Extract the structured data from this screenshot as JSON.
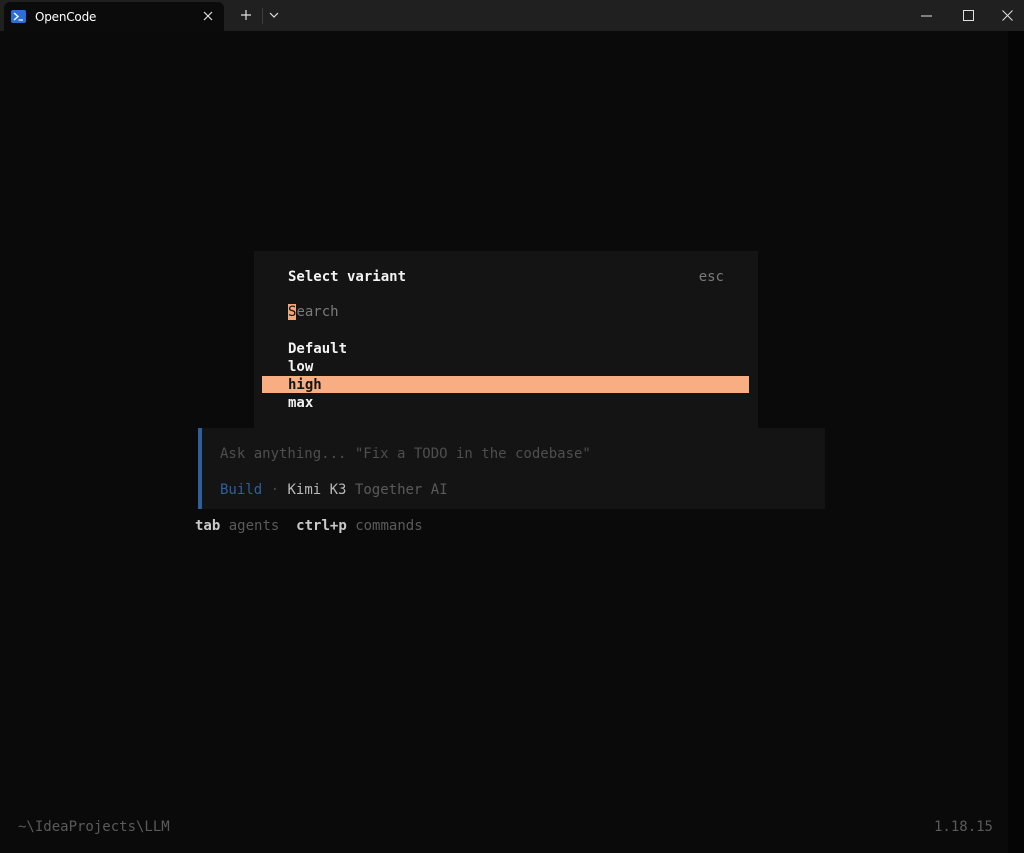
{
  "window": {
    "tab_title": "OpenCode",
    "new_tab_symbol": "+",
    "dropdown_symbol": "⌄",
    "tab_close_symbol": "✕"
  },
  "colors": {
    "accent": "#f8ad82",
    "agent_blue": "#2f5f9e",
    "background": "#0a0a0a",
    "panel": "#141414"
  },
  "modal": {
    "title": "Select variant",
    "close_hint": "esc",
    "search_cursor_char": "S",
    "search_placeholder_rest": "earch",
    "options": [
      {
        "label": "Default",
        "selected": false
      },
      {
        "label": "low",
        "selected": false
      },
      {
        "label": "high",
        "selected": true
      },
      {
        "label": "max",
        "selected": false
      }
    ]
  },
  "prompt": {
    "placeholder": "Ask anything... \"Fix a TODO in the codebase\"",
    "agent": "Build",
    "separator": "·",
    "model": "Kimi K3",
    "provider": "Together AI"
  },
  "hints": [
    {
      "key": "tab",
      "label": "agents"
    },
    {
      "key": "ctrl+p",
      "label": "commands"
    }
  ],
  "footer": {
    "path": "~\\IdeaProjects\\LLM",
    "version": "1.18.15"
  }
}
